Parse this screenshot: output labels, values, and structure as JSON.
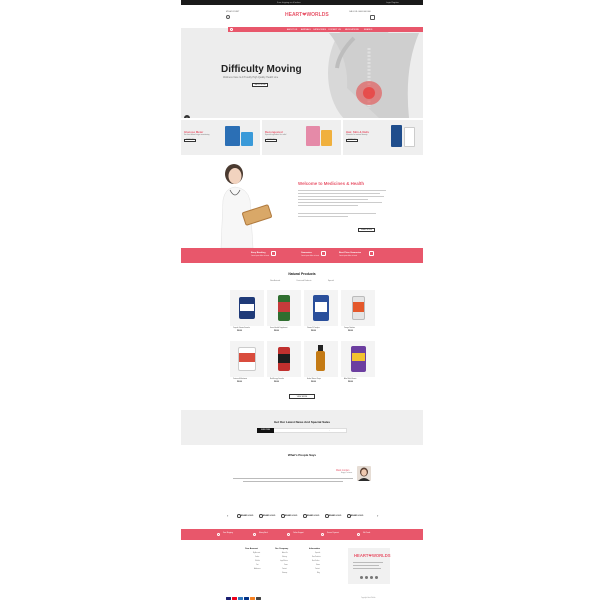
{
  "colors": {
    "accent": "#e8576b",
    "dark": "#1a1a1a",
    "panel": "#efefef"
  },
  "topbar": {
    "promo": "Free shipping on all orders",
    "links": "Login  Register"
  },
  "header": {
    "logo": "HEART",
    "logo_suffix": "WORLDS",
    "account_label": "MY ACCOUNT",
    "phone_label": "CALL US: 0000 000 000",
    "icons": [
      "account-icon",
      "cart-icon"
    ]
  },
  "nav": {
    "items": [
      "ABOUT US",
      "ARRIVALS",
      "CATEGORIES",
      "CONTACT US",
      "MEDICATIONS",
      "BRANDS"
    ]
  },
  "hero": {
    "title": "Difficulty Moving",
    "subtitle": "Wellness Care Is A Proudly High Quality Health Line",
    "button": "SHOP NOW"
  },
  "categories": [
    {
      "title": "Glucose Meter",
      "desc": "For best blood sugar monitoring",
      "button": "SHOP NOW"
    },
    {
      "title": "Decongested",
      "desc": "Special ingredient for relief",
      "button": "SHOP NOW"
    },
    {
      "title": "Hair, Skin & Nails",
      "desc": "Vitamins for natural beauty",
      "button": "SHOP NOW"
    }
  ],
  "welcome": {
    "title": "Welcome to Medicines & Health",
    "button": "READ MORE"
  },
  "features": [
    {
      "title": "Easy Booking",
      "sub": "Lorem ipsum dolor sit amet"
    },
    {
      "title": "Guarantee",
      "sub": "Lorem ipsum dolor sit amet"
    },
    {
      "title": "Best Price Guarantee",
      "sub": "Lorem ipsum dolor sit amet"
    }
  ],
  "products": {
    "title": "Natural Products",
    "tabs": [
      "New Arrivals",
      "Featured Products",
      "Special"
    ],
    "items": [
      {
        "name": "Capsule Vitamin Formula",
        "price": "$30.00"
      },
      {
        "name": "Green Herbal Supplement",
        "price": "$30.00"
      },
      {
        "name": "Vitamin B Complex",
        "price": "$30.00"
      },
      {
        "name": "Omega Nutrition",
        "price": "$30.00"
      },
      {
        "name": "Centrum Multivitamin",
        "price": "$30.00"
      },
      {
        "name": "Red Energy Formula",
        "price": "$30.00"
      },
      {
        "name": "Herbal Extract Drops",
        "price": "$30.00"
      },
      {
        "name": "Alive Multi-Vitamin",
        "price": "$30.00"
      }
    ],
    "view_button": "VIEW MORE"
  },
  "newsletter": {
    "title": "Get Our Latest News And Special Sales",
    "button": "SUBSCRIBE",
    "placeholder": "Enter your email"
  },
  "testimonials": {
    "title": "What's People Says",
    "name": "Mark Jordan",
    "role": "Happy Customer"
  },
  "brands": [
    "BRAND LOGO",
    "BRAND LOGO",
    "BRAND LOGO",
    "BRAND LOGO",
    "BRAND LOGO",
    "BRAND LOGO"
  ],
  "footer_strip": [
    "Free Shipping",
    "Money Back",
    "Online Support",
    "Secure Payment",
    "Gift Cards"
  ],
  "footer": {
    "columns": [
      {
        "title": "Your Account",
        "links": [
          "My Account",
          "Orders",
          "Wishlist",
          "Cart",
          "Addresses"
        ]
      },
      {
        "title": "Our Company",
        "links": [
          "About Us",
          "Delivery",
          "Legal Notice",
          "Terms",
          "Contact",
          "Sitemap"
        ]
      },
      {
        "title": "Information",
        "links": [
          "Specials",
          "New Products",
          "Best Sellers",
          "Stores",
          "Contact",
          "Blog"
        ]
      }
    ],
    "logo": "HEART",
    "logo_suffix": "WORLDS",
    "copyright": "Copyright Heart Worlds"
  }
}
